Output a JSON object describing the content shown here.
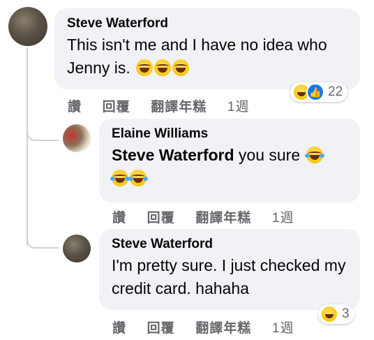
{
  "comments": [
    {
      "author": "Steve Waterford",
      "text": "This isn't me and I have no idea who Jenny is.",
      "emojis": [
        "rolling-laughing-emoji",
        "rolling-laughing-emoji",
        "rolling-laughing-emoji"
      ],
      "reactions": {
        "icons": [
          "haha-reaction-icon",
          "like-reaction-icon"
        ],
        "count": "22"
      },
      "actions": {
        "like": "讚",
        "reply": "回覆",
        "translate": "翻譯年糕",
        "time": "1週"
      }
    },
    {
      "author": "Elaine Williams",
      "mention": "Steve Waterford",
      "text": " you sure",
      "emojis": [
        "tears-of-joy-emoji",
        "tears-of-joy-emoji",
        "tears-of-joy-emoji"
      ],
      "actions": {
        "like": "讚",
        "reply": "回覆",
        "translate": "翻譯年糕",
        "time": "1週"
      }
    },
    {
      "author": "Steve Waterford",
      "text": "I'm pretty sure. I just checked my credit card. hahaha",
      "reactions": {
        "icons": [
          "haha-reaction-icon"
        ],
        "count": "3"
      },
      "actions": {
        "like": "讚",
        "reply": "回覆",
        "translate": "翻譯年糕",
        "time": "1週"
      }
    }
  ]
}
